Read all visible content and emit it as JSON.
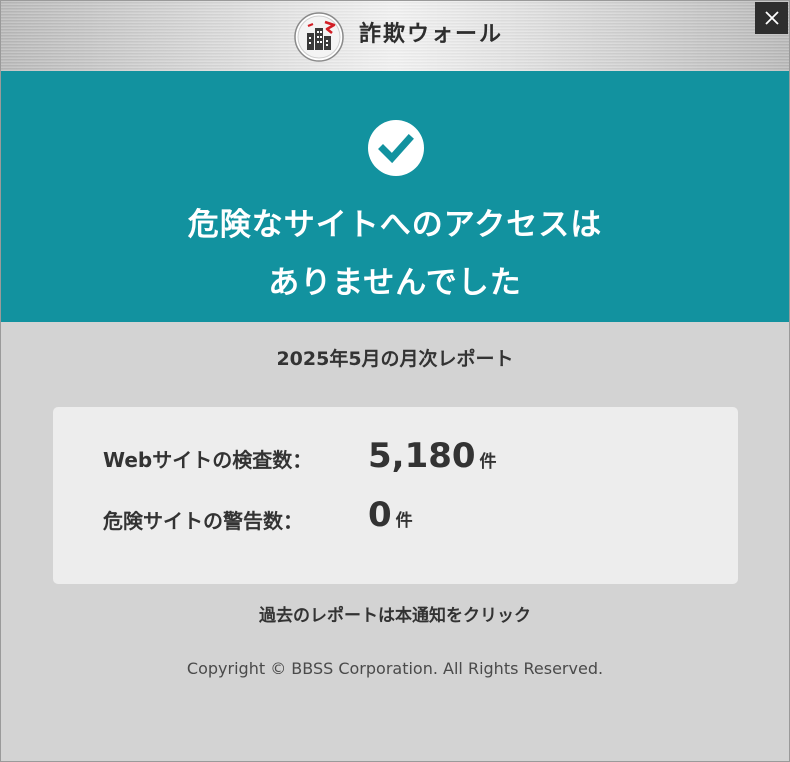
{
  "header": {
    "app_title": "詐欺ウォール",
    "logo_icon": "building-shield-logo",
    "close_icon": "close-icon"
  },
  "banner": {
    "status_icon": "check-circle-icon",
    "headline_line1": "危険なサイトへのアクセスは",
    "headline_line2": "ありませんでした",
    "background_color": "#12929f"
  },
  "report": {
    "title": "2025年5月の月次レポート",
    "stats": [
      {
        "label": "Webサイトの検査数：",
        "value": "5,180",
        "unit": "件"
      },
      {
        "label": "危険サイトの警告数：",
        "value": "0",
        "unit": "件"
      }
    ]
  },
  "footer": {
    "past_reports_link": "過去のレポートは本通知をクリック",
    "copyright": "Copyright © BBSS Corporation. All Rights Reserved."
  },
  "colors": {
    "accent": "#12929f",
    "text": "#333333",
    "page_background": "#d3d3d3",
    "card_background": "#ededed"
  }
}
